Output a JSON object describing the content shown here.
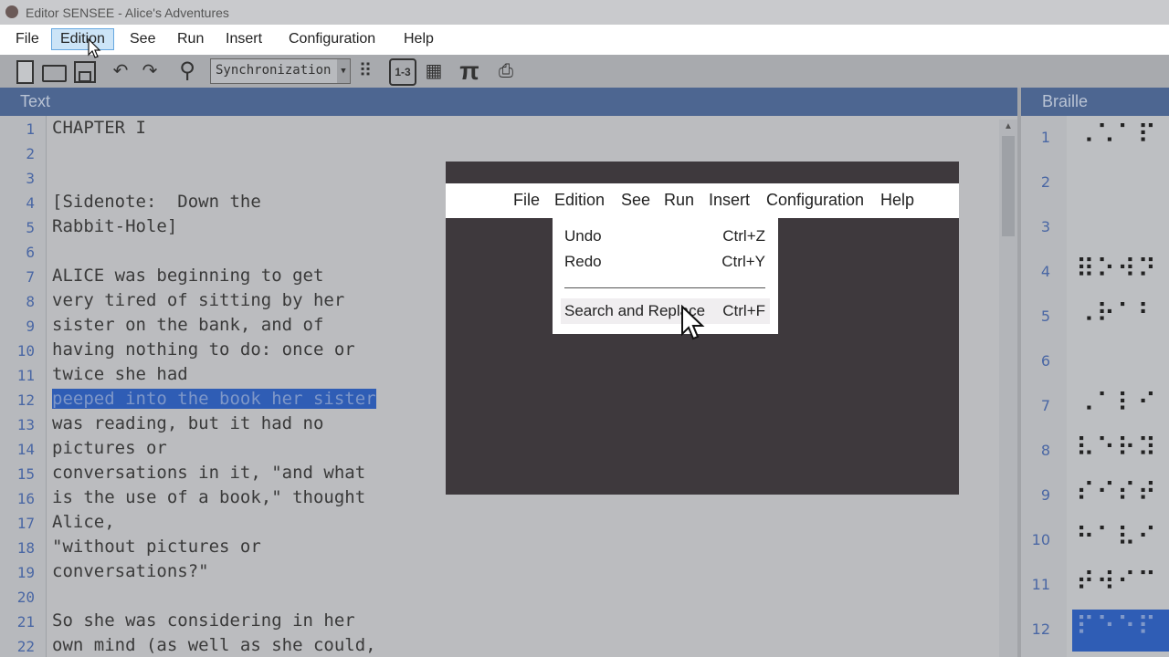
{
  "window": {
    "title": "Editor SENSEE - Alice's Adventures"
  },
  "menubar": {
    "items": [
      "File",
      "Edition",
      "See",
      "Run",
      "Insert",
      "Configuration",
      "Help"
    ],
    "active": "Edition"
  },
  "toolbar": {
    "combo_value": "Synchronization",
    "pi_symbol": "π",
    "numbering_label": "1-3"
  },
  "text_panel": {
    "header": "Text",
    "lines": [
      {
        "n": "1",
        "t": "CHAPTER I"
      },
      {
        "n": "2",
        "t": ""
      },
      {
        "n": "3",
        "t": ""
      },
      {
        "n": "4",
        "t": "[Sidenote:  Down the"
      },
      {
        "n": "5",
        "t": "Rabbit-Hole]"
      },
      {
        "n": "6",
        "t": ""
      },
      {
        "n": "7",
        "t": "ALICE was beginning to get"
      },
      {
        "n": "8",
        "t": "very tired of sitting by her"
      },
      {
        "n": "9",
        "t": "sister on the bank, and of"
      },
      {
        "n": "10",
        "t": "having nothing to do: once or"
      },
      {
        "n": "11",
        "t": "twice she had"
      },
      {
        "n": "12",
        "t": "peeped into the book her sister",
        "selected": true
      },
      {
        "n": "13",
        "t": "was reading, but it had no"
      },
      {
        "n": "14",
        "t": "pictures or"
      },
      {
        "n": "15",
        "t": "conversations in it, \"and what"
      },
      {
        "n": "16",
        "t": "is the use of a book,\" thought"
      },
      {
        "n": "17",
        "t": "Alice,"
      },
      {
        "n": "18",
        "t": "\"without pictures or"
      },
      {
        "n": "19",
        "t": "conversations?\""
      },
      {
        "n": "20",
        "t": ""
      },
      {
        "n": "21",
        "t": "So she was considering in her"
      },
      {
        "n": "22",
        "t": "own mind (as well as she could,"
      }
    ]
  },
  "braille_panel": {
    "header": "Braille",
    "rows": [
      {
        "n": "1",
        "cells": "⠠⠡⠁⠏"
      },
      {
        "n": "2",
        "cells": ""
      },
      {
        "n": "3",
        "cells": ""
      },
      {
        "n": "4",
        "cells": "⠿⠕⠺⠝"
      },
      {
        "n": "5",
        "cells": "⠠⠗⠁⠃"
      },
      {
        "n": "6",
        "cells": ""
      },
      {
        "n": "7",
        "cells": "⠠⠁⠇⠊"
      },
      {
        "n": "8",
        "cells": "⠧⠑⠗⠽"
      },
      {
        "n": "9",
        "cells": "⠎⠊⠎⠞"
      },
      {
        "n": "10",
        "cells": "⠓⠁⠧⠊"
      },
      {
        "n": "11",
        "cells": "⠞⠺⠊⠉"
      },
      {
        "n": "12",
        "cells": "⠏⠑⠑⠏",
        "selected": true
      }
    ]
  },
  "overlay": {
    "menubar": [
      "File",
      "Edition",
      "See",
      "Run",
      "Insert",
      "Configuration",
      "Help"
    ],
    "dropdown": [
      {
        "label": "Undo",
        "shortcut": "Ctrl+Z"
      },
      {
        "label": "Redo",
        "shortcut": "Ctrl+Y"
      },
      {
        "label": "Search and Replace",
        "shortcut": "Ctrl+F",
        "highlighted": true
      }
    ]
  }
}
